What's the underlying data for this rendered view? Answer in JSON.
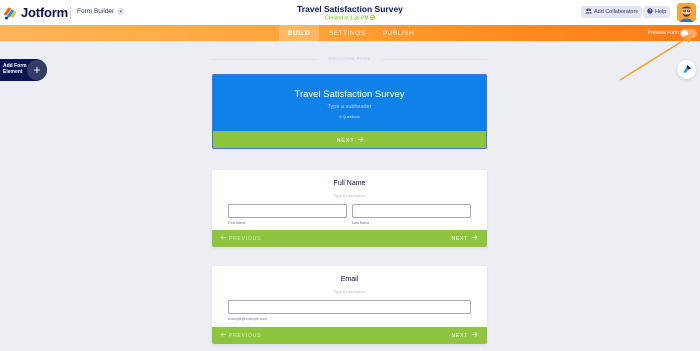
{
  "header": {
    "logo_text": "Jotform",
    "builder_label": "Form Builder",
    "form_title": "Travel Satisfaction Survey",
    "created_text": "Created at 1:36 PM",
    "add_collaborators": "Add Collaborators",
    "help": "Help"
  },
  "nav": {
    "tabs": [
      {
        "label": "BUILD",
        "active": true
      },
      {
        "label": "SETTINGS",
        "active": false
      },
      {
        "label": "PUBLISH",
        "active": false
      }
    ],
    "preview_label": "Preview Form",
    "preview_enabled": false
  },
  "add_element": {
    "label": "Add Form Element",
    "plus": "+"
  },
  "page_label": "WELCOME PAGE",
  "welcome": {
    "title": "Travel Satisfaction Survey",
    "subheader_placeholder": "Type a subheader",
    "question_count": "5 Questions",
    "next": "NEXT"
  },
  "questions": [
    {
      "title": "Full Name",
      "description_placeholder": "Type a description",
      "sublabels": [
        "First Name",
        "Last Name"
      ],
      "previous": "PREVIOUS",
      "next": "NEXT"
    },
    {
      "title": "Email",
      "description_placeholder": "Type a description",
      "sublabels": [
        "example@example.com"
      ],
      "previous": "PREVIOUS",
      "next": "NEXT"
    }
  ],
  "colors": {
    "brand_navy": "#0a1551",
    "accent_orange": "#ff7b1a",
    "welcome_blue": "#0f81e8",
    "button_green": "#8fc43f",
    "annotation_arrow": "#f7a235"
  },
  "icons": {
    "logo": "jotform-logo-icon",
    "chevron": "chevron-down-icon",
    "collaborators": "people-icon",
    "help": "help-icon",
    "fab": "paint-roller-icon",
    "next_arrow": "arrow-right-icon",
    "prev_arrow": "arrow-left-icon"
  }
}
